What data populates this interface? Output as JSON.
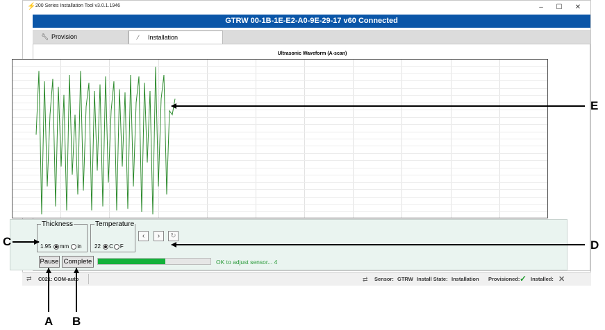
{
  "app": {
    "title": "200 Series Installation Tool v3.0.1.1946",
    "banner": "GTRW  00-1B-1E-E2-A0-9E-29-17  v60  Connected"
  },
  "window_controls": {
    "minimize": "–",
    "maximize": "☐",
    "close": "✕"
  },
  "tabs": [
    {
      "label": "Provision",
      "icon": "wrench-icon",
      "active": false
    },
    {
      "label": "Installation",
      "icon": "wand-icon",
      "active": true
    }
  ],
  "chart_data": {
    "type": "line",
    "title": "Ultrasonic Waveform (A-scan)",
    "xlabel": "",
    "ylabel": "",
    "grid": true,
    "xlim": [
      0,
      772
    ],
    "ylim": [
      -1,
      1
    ],
    "series": [
      {
        "color": "#2e8b2e",
        "x": [
          0,
          4,
          8,
          12,
          16,
          20,
          24,
          28,
          32,
          36,
          40,
          44,
          48,
          52,
          56,
          60,
          64,
          68,
          72,
          76,
          80,
          84,
          88,
          92,
          96,
          100,
          104,
          108,
          112,
          116,
          120,
          124,
          128,
          132,
          136,
          140,
          144,
          148,
          152,
          156,
          160,
          164,
          168,
          172,
          176,
          180,
          184,
          188,
          192,
          196,
          200
        ],
        "values": [
          0.05,
          0.85,
          -0.95,
          0.72,
          -0.6,
          0.3,
          0.75,
          -0.85,
          0.65,
          -0.35,
          0.55,
          -0.9,
          0.8,
          -0.45,
          0.3,
          -0.7,
          0.85,
          -0.65,
          0.4,
          0.7,
          -0.9,
          0.6,
          -0.4,
          0.68,
          -0.85,
          0.78,
          -0.55,
          0.35,
          0.72,
          -0.9,
          0.62,
          -0.35,
          0.58,
          -0.88,
          0.8,
          -0.6,
          0.45,
          0.78,
          -0.92,
          0.7,
          -0.3,
          0.6,
          -0.95,
          0.9,
          -0.6,
          0.5,
          0.8,
          -0.7,
          0.35,
          0.3,
          0.5
        ]
      }
    ]
  },
  "thickness": {
    "legend": "Thickness",
    "value": "1.95",
    "unit_a": "mm",
    "unit_b": "in",
    "selected": "mm"
  },
  "temperature": {
    "legend": "Temperature",
    "value": "22",
    "unit_a": "C",
    "unit_b": "F",
    "selected": "C"
  },
  "nav": {
    "prev_icon": "chevron-left-icon",
    "next_icon": "chevron-right-icon",
    "reset_icon": "reset-icon"
  },
  "buttons": {
    "pause": "Pause",
    "complete": "Complete"
  },
  "progress": {
    "value": 0.6
  },
  "status_message": "OK to adjust sensor... 4",
  "statusbar": {
    "port": "C021: COM-auto",
    "sensor_label": "Sensor:",
    "sensor_value": "GTRW",
    "install_state_label": "Install State:",
    "install_state_value": "Installation",
    "provisioned_label": "Provisioned:",
    "provisioned_mark": "✓",
    "installed_label": "Installed:",
    "installed_mark": "✕"
  },
  "annotations": {
    "a": "A",
    "b": "B",
    "c": "C",
    "d": "D",
    "e": "E"
  }
}
